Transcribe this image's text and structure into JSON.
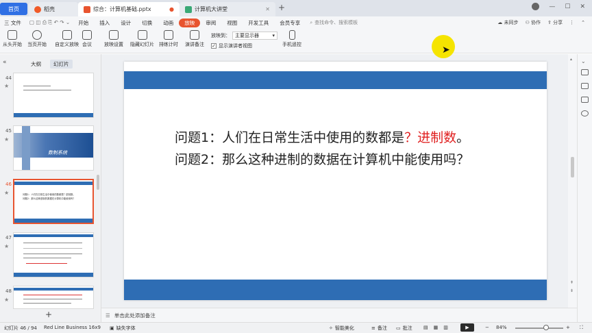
{
  "tabs": {
    "home": "首页",
    "wps": "稻壳",
    "doc": "综合：计算机基础.pptx",
    "doc2": "计算机大讲堂",
    "plus": "+"
  },
  "topright": {
    "min": "—",
    "max": "☐",
    "close": "✕",
    "n": "3"
  },
  "menu": {
    "file": "三 文件",
    "items": [
      "开始",
      "插入",
      "设计",
      "切换",
      "动画",
      "放映",
      "审阅",
      "视图",
      "开发工具",
      "会员专享"
    ],
    "active_index": 5,
    "search_placeholder": "查找命令、搜索模板",
    "unsynced": "未同步",
    "collab": "协作",
    "share": "分享"
  },
  "ribbon": {
    "from_start": "从头开始",
    "from_current": "当页开始",
    "custom": "自定义放映",
    "meeting": "会议",
    "setup": "放映设置",
    "hide": "隐藏幻灯片",
    "rehearse": "排练计时",
    "notes": "演讲备注",
    "show_on_label": "放映到：",
    "show_on_value": "主要显示器",
    "presenter_view": "显示演讲者视图",
    "remote": "手机遥控"
  },
  "leftpanel": {
    "tab_outline": "大纲",
    "tab_slides": "幻灯片",
    "collapse": "«",
    "slides": [
      {
        "num": "44"
      },
      {
        "num": "45",
        "caption": "数制系统"
      },
      {
        "num": "46",
        "line1": "问题1：人们在日常生活中使用的数都是？进制数。",
        "line2": "问题2：那么这种进制的数据在计算机中能使用吗？"
      },
      {
        "num": "47"
      },
      {
        "num": "48"
      }
    ],
    "add": "+"
  },
  "slide": {
    "q1_prefix": "问题1：人们在日常生活中使用的数都是",
    "q1_red": "？进制数",
    "q1_suffix": "。",
    "q2": "问题2：那么这种进制的数据在计算机中能使用吗？"
  },
  "notes_placeholder": "单击此处添加备注",
  "status": {
    "slide_info": "幻灯片 46 / 94",
    "theme": "Red Line Business 16x9",
    "missing_font": "缺失字体",
    "smart": "智能美化",
    "notes": "备注",
    "comment": "批注",
    "zoom": "84%"
  },
  "colors": {
    "accent": "#e8542f",
    "band": "#2e6db4",
    "red_text": "#e02020",
    "home_tab": "#2f6fe4"
  }
}
